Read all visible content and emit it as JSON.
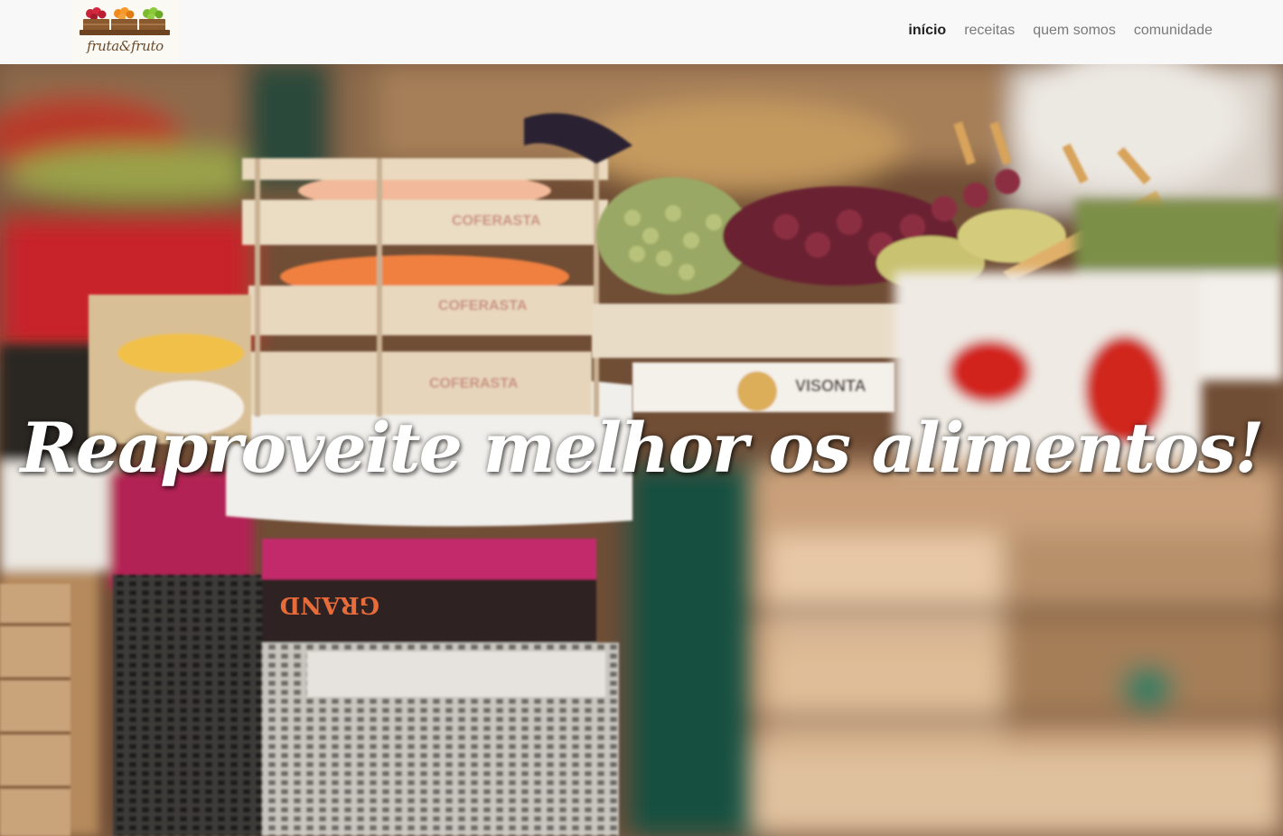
{
  "brand": {
    "name": "fruta&fruto",
    "colors": {
      "crate": "#8a5a2e",
      "berries": "#c8243a",
      "orange": "#ef8a1e",
      "green": "#7cbb2f"
    }
  },
  "nav": {
    "items": [
      {
        "label": "início",
        "active": true
      },
      {
        "label": "receitas",
        "active": false
      },
      {
        "label": "quem somos",
        "active": false
      },
      {
        "label": "comunidade",
        "active": false
      }
    ]
  },
  "hero": {
    "title": "Reaproveite melhor os alimentos!",
    "crate_labels": [
      "COFERASTA",
      "COFERASTA",
      "COFERASTA",
      "VISONTA",
      "GRAND"
    ]
  }
}
